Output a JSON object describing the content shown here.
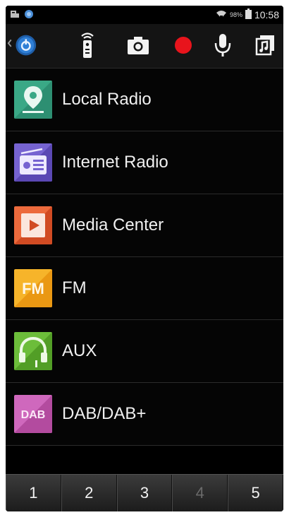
{
  "status_bar": {
    "battery_percent": "98%",
    "time": "10:58",
    "icons": [
      "notification-icon",
      "android-icon",
      "wifi-icon",
      "battery-icon"
    ]
  },
  "action_bar": {
    "items": [
      {
        "name": "back-app-icon"
      },
      {
        "name": "remote-icon"
      },
      {
        "name": "camera-icon"
      },
      {
        "name": "record-icon",
        "color": "#e8141c"
      },
      {
        "name": "microphone-icon"
      },
      {
        "name": "music-library-icon"
      }
    ]
  },
  "menu": {
    "items": [
      {
        "label": "Local Radio",
        "icon": "local-radio-icon",
        "color": "#2f9c7c"
      },
      {
        "label": "Internet Radio",
        "icon": "internet-radio-icon",
        "color": "#6a55c2"
      },
      {
        "label": "Media Center",
        "icon": "media-center-icon",
        "color": "#e4572e"
      },
      {
        "label": "FM",
        "icon": "fm-icon",
        "icon_text": "FM",
        "color": "#f2a51a"
      },
      {
        "label": "AUX",
        "icon": "aux-icon",
        "color": "#5fb232"
      },
      {
        "label": "DAB/DAB+",
        "icon": "dab-icon",
        "icon_text": "DAB",
        "color": "#c25bb0"
      }
    ]
  },
  "num_bar": {
    "buttons": [
      {
        "label": "1",
        "enabled": true
      },
      {
        "label": "2",
        "enabled": true
      },
      {
        "label": "3",
        "enabled": true
      },
      {
        "label": "4",
        "enabled": false
      },
      {
        "label": "5",
        "enabled": true
      }
    ]
  }
}
